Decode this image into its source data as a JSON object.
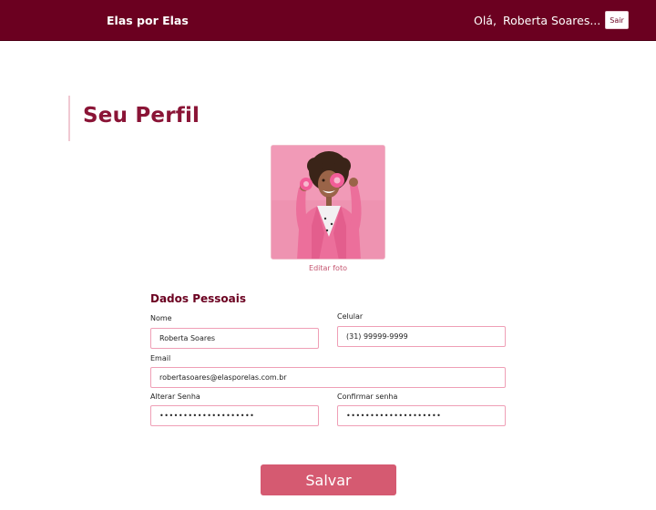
{
  "header": {
    "brand": "Elas por Elas",
    "greeting_prefix": "Olá,",
    "user_name": "Roberta Soares...",
    "logout_label": "Sair"
  },
  "page": {
    "title": "Seu Perfil"
  },
  "profile_photo": {
    "edit_label": "Editar foto"
  },
  "personal_data": {
    "section_title": "Dados Pessoais",
    "name": {
      "label": "Nome",
      "value": "Roberta Soares"
    },
    "phone": {
      "label": "Celular",
      "value": "(31) 99999-9999"
    },
    "email": {
      "label": "Email",
      "value": "robertasoares@elasporelas.com.br"
    },
    "new_password": {
      "label": "Alterar Senha",
      "value": "••••••••••••••••••••"
    },
    "confirm_password": {
      "label": "Confirmar senha",
      "value": "••••••••••••••••••••"
    }
  },
  "actions": {
    "save_label": "Salvar"
  },
  "colors": {
    "header_bg": "#6b0020",
    "title": "#8a1436",
    "accent": "#d55a71",
    "field_border": "#ef9fb6"
  }
}
